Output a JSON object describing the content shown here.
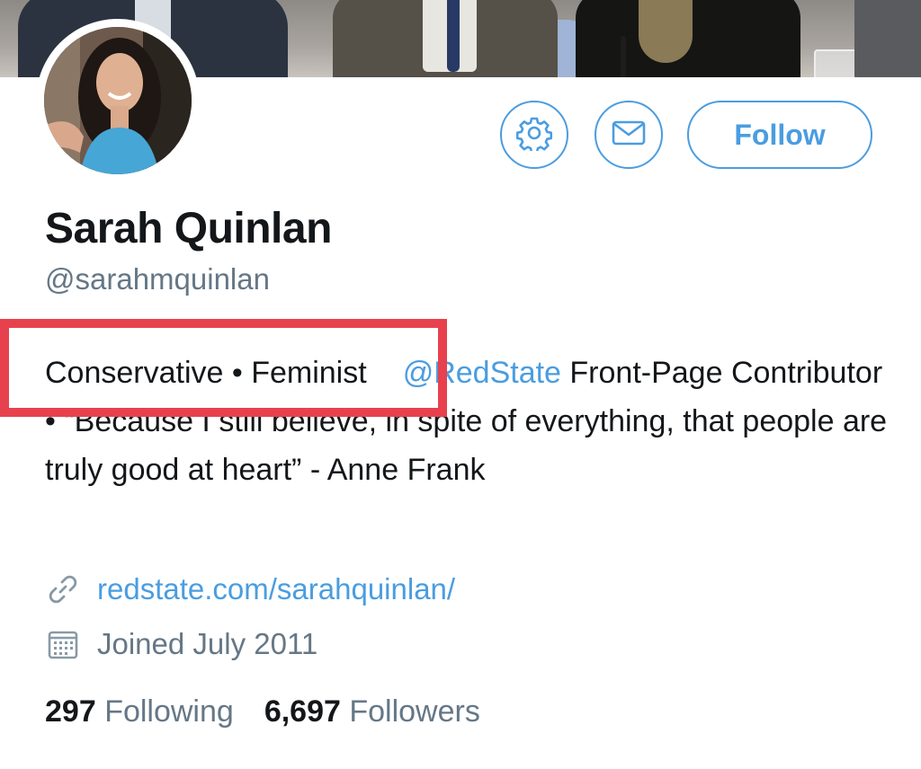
{
  "profile": {
    "name": "Sarah Quinlan",
    "handle": "@sarahmquinlan",
    "bio": {
      "part1": "Conservative • Feminist",
      "mention": "@RedState",
      "part2": " Front-Page Contributor •  “Because I still believe, in spite of everything, that people are truly good at heart” - Anne Frank"
    },
    "website": "redstate.com/sarahquinlan/",
    "joined": "Joined July 2011",
    "following_count": "297",
    "following_label": "Following",
    "followers_count": "6,697",
    "followers_label": "Followers"
  },
  "actions": {
    "follow_label": "Follow",
    "settings_icon": "gear-icon",
    "message_icon": "envelope-icon"
  },
  "colors": {
    "accent": "#4a9de0",
    "muted": "#657786",
    "text": "#14171a",
    "highlight": "#e8414e"
  }
}
